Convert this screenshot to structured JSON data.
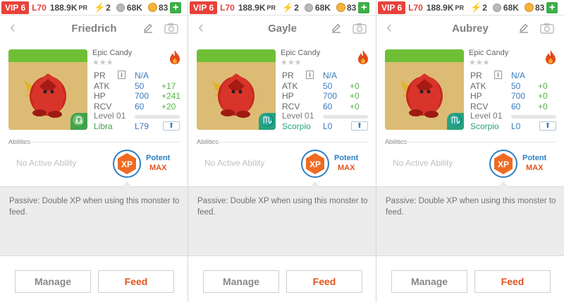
{
  "status_bar": {
    "vip": "VIP 6",
    "level": "L70",
    "power": "188.9K",
    "power_suffix": "PR",
    "energy": "2",
    "silver": "68K",
    "gold": "83",
    "plus": "+"
  },
  "icons": {
    "back": "chevron-left-icon",
    "edit": "pencil-icon",
    "camera": "camera-icon",
    "element": "fire-icon",
    "level_up": "arrow-up-icon",
    "xp": "xp-badge-icon"
  },
  "colors": {
    "accent_red": "#e8413a",
    "stat_blue": "#3b7bbf",
    "bonus_green": "#58b14a",
    "feed_orange": "#e1531e"
  },
  "panels": [
    {
      "title": "Friedrich",
      "monster_name": "Epic Candy",
      "stars": "★★★",
      "labels": {
        "pr": "PR",
        "atk": "ATK",
        "hp": "HP",
        "rcv": "RCV"
      },
      "info_icon": "i",
      "pr_value": "N/A",
      "atk": "50",
      "atk_bonus": "+17",
      "hp": "700",
      "hp_bonus": "+241",
      "rcv": "60",
      "rcv_bonus": "+20",
      "level": "Level 01",
      "sign": "Libra",
      "sign_symbol": "♎",
      "rank": "L79",
      "abilities_label": "Abilities",
      "no_ability": "No Active Ability",
      "xp_label": "XP",
      "potent": "Potent",
      "max": "MAX",
      "passive": "Passive: Double XP when using this monster to feed.",
      "manage": "Manage",
      "feed": "Feed"
    },
    {
      "title": "Gayle",
      "monster_name": "Epic Candy",
      "stars": "★★★",
      "labels": {
        "pr": "PR",
        "atk": "ATK",
        "hp": "HP",
        "rcv": "RCV"
      },
      "info_icon": "i",
      "pr_value": "N/A",
      "atk": "50",
      "atk_bonus": "+0",
      "hp": "700",
      "hp_bonus": "+0",
      "rcv": "60",
      "rcv_bonus": "+0",
      "level": "Level 01",
      "sign": "Scorpio",
      "sign_symbol": "♏",
      "rank": "L0",
      "abilities_label": "Abilities",
      "no_ability": "No Active Ability",
      "xp_label": "XP",
      "potent": "Potent",
      "max": "MAX",
      "passive": "Passive: Double XP when using this monster to feed.",
      "manage": "Manage",
      "feed": "Feed"
    },
    {
      "title": "Aubrey",
      "monster_name": "Epic Candy",
      "stars": "★★★",
      "labels": {
        "pr": "PR",
        "atk": "ATK",
        "hp": "HP",
        "rcv": "RCV"
      },
      "info_icon": "i",
      "pr_value": "N/A",
      "atk": "50",
      "atk_bonus": "+0",
      "hp": "700",
      "hp_bonus": "+0",
      "rcv": "60",
      "rcv_bonus": "+0",
      "level": "Level 01",
      "sign": "Scorpio",
      "sign_symbol": "♏",
      "rank": "L0",
      "abilities_label": "Abilities",
      "no_ability": "No Active Ability",
      "xp_label": "XP",
      "potent": "Potent",
      "max": "MAX",
      "passive": "Passive: Double XP when using this monster to feed.",
      "manage": "Manage",
      "feed": "Feed"
    }
  ]
}
